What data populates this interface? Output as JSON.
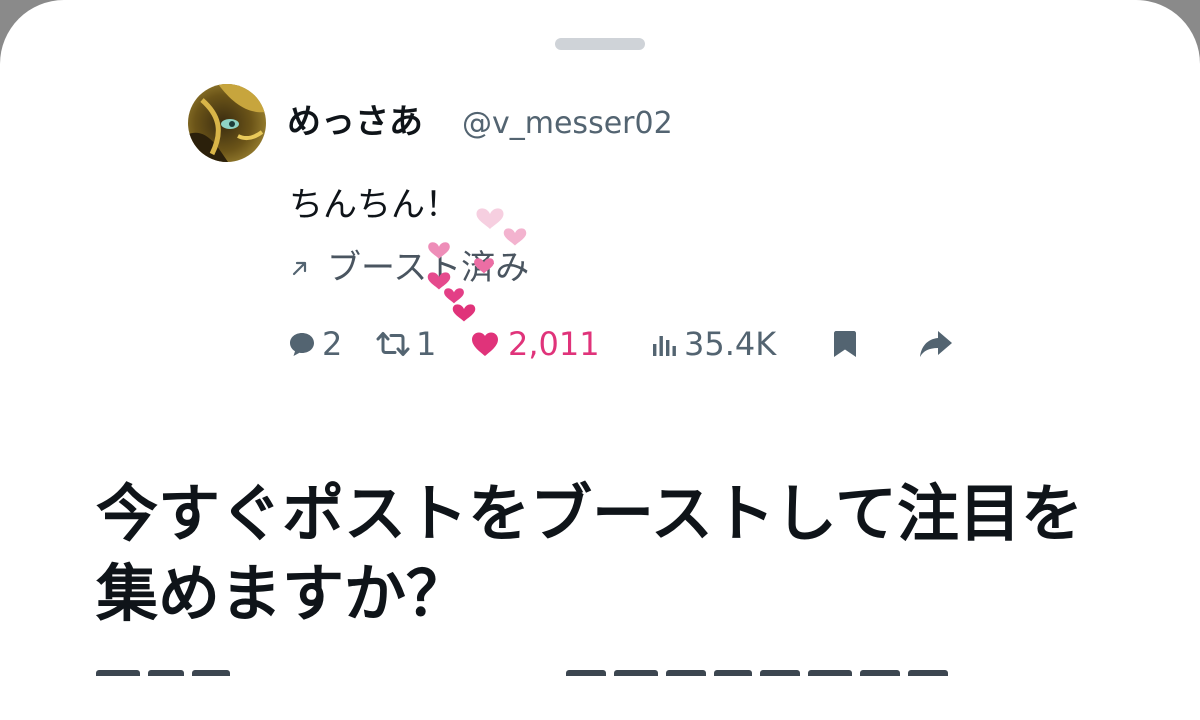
{
  "post": {
    "author_name": "めっさあ",
    "author_handle": "@v_messer02",
    "text": "ちんちん！",
    "boost_status": "ブースト済み",
    "metrics": {
      "replies": "2",
      "reposts": "1",
      "likes": "2,011",
      "views": "35.4K"
    }
  },
  "prompt": {
    "headline": "今すぐポストをブーストして注目を集めますか？"
  },
  "colors": {
    "like_pink": "#e0337a",
    "muted": "#536471",
    "text": "#0f1419"
  },
  "icons": [
    "reply-icon",
    "repost-icon",
    "heart-icon",
    "views-icon",
    "bookmark-icon",
    "share-icon",
    "boost-arrow-icon"
  ]
}
